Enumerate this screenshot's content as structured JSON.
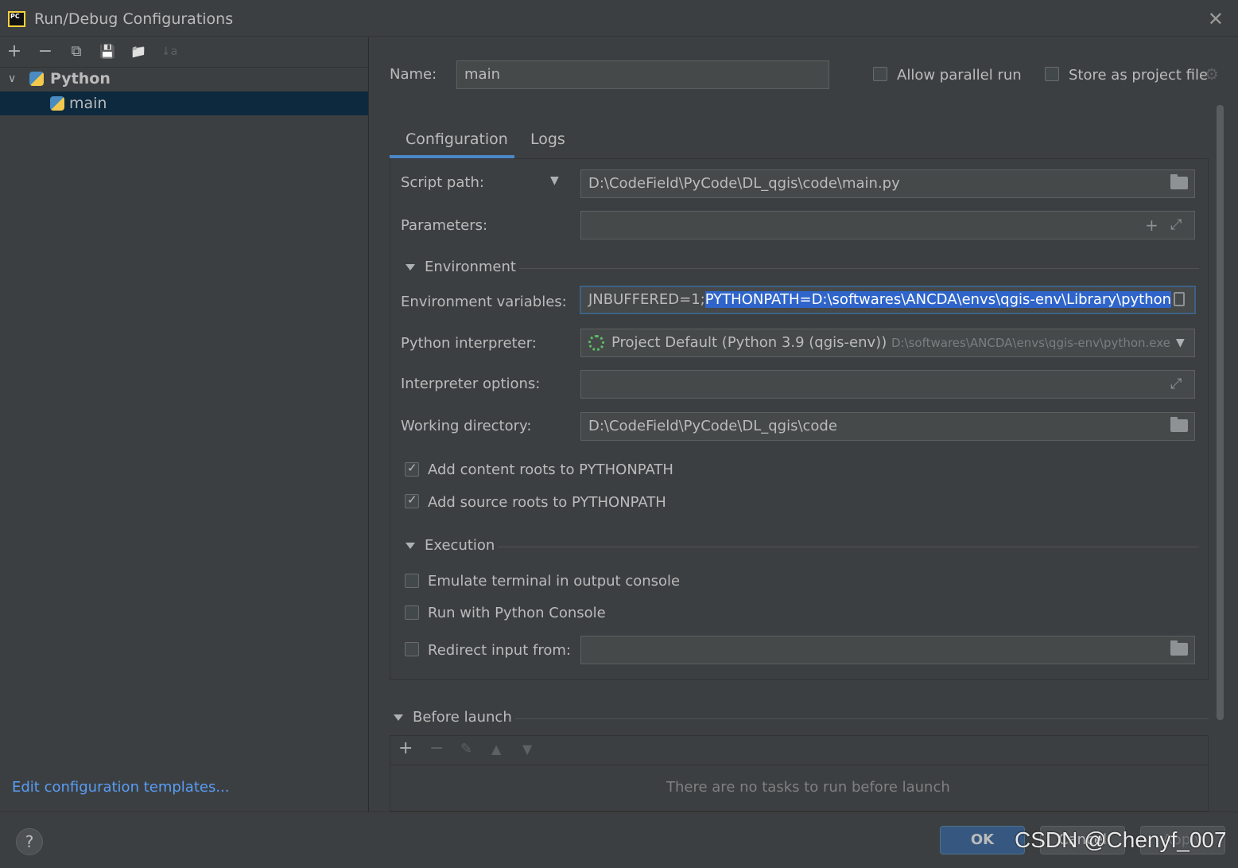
{
  "window": {
    "title": "Run/Debug Configurations",
    "app_icon_label": "PC"
  },
  "toolbar": {
    "add": "+",
    "remove": "−",
    "copy": "⧉",
    "save": "💾",
    "folder": "📁",
    "sort": "↓a"
  },
  "tree": {
    "group_label": "Python",
    "item_label": "main"
  },
  "left_footer": {
    "edit_templates": "Edit configuration templates..."
  },
  "header": {
    "name_label": "Name:",
    "name_value": "main",
    "allow_parallel": "Allow parallel run",
    "store_project": "Store as project file"
  },
  "tabs": [
    {
      "label": "Configuration"
    },
    {
      "label": "Logs"
    }
  ],
  "config": {
    "script_path_label": "Script path:",
    "script_path_value": "D:\\CodeField\\PyCode\\DL_qgis\\code\\main.py",
    "parameters_label": "Parameters:",
    "environment_section": "Environment",
    "env_vars_label": "Environment variables:",
    "env_vars_prefix": "JNBUFFERED=1;",
    "env_vars_selected": "PYTHONPATH=D:\\softwares\\ANCDA\\envs\\qgis-env\\Library\\python",
    "interpreter_label": "Python interpreter:",
    "interpreter_value": "Project Default (Python 3.9 (qgis-env))",
    "interpreter_path": "D:\\softwares\\ANCDA\\envs\\qgis-env\\python.exe",
    "interp_options_label": "Interpreter options:",
    "working_dir_label": "Working directory:",
    "working_dir_value": "D:\\CodeField\\PyCode\\DL_qgis\\code",
    "add_content_roots": "Add content roots to PYTHONPATH",
    "add_source_roots": "Add source roots to PYTHONPATH",
    "execution_section": "Execution",
    "emulate_terminal": "Emulate terminal in output console",
    "run_python_console": "Run with Python Console",
    "redirect_input": "Redirect input from:"
  },
  "before_launch": {
    "section": "Before launch",
    "empty_text": "There are no tasks to run before launch"
  },
  "buttons": {
    "help": "?",
    "ok": "OK",
    "cancel": "Cancel",
    "apply": "Apply"
  },
  "watermark": "CSDN @Chenyf_007",
  "colors": {
    "accent": "#4a88c7",
    "link": "#589df6",
    "selection": "#0d293e",
    "ok_button": "#365880"
  }
}
